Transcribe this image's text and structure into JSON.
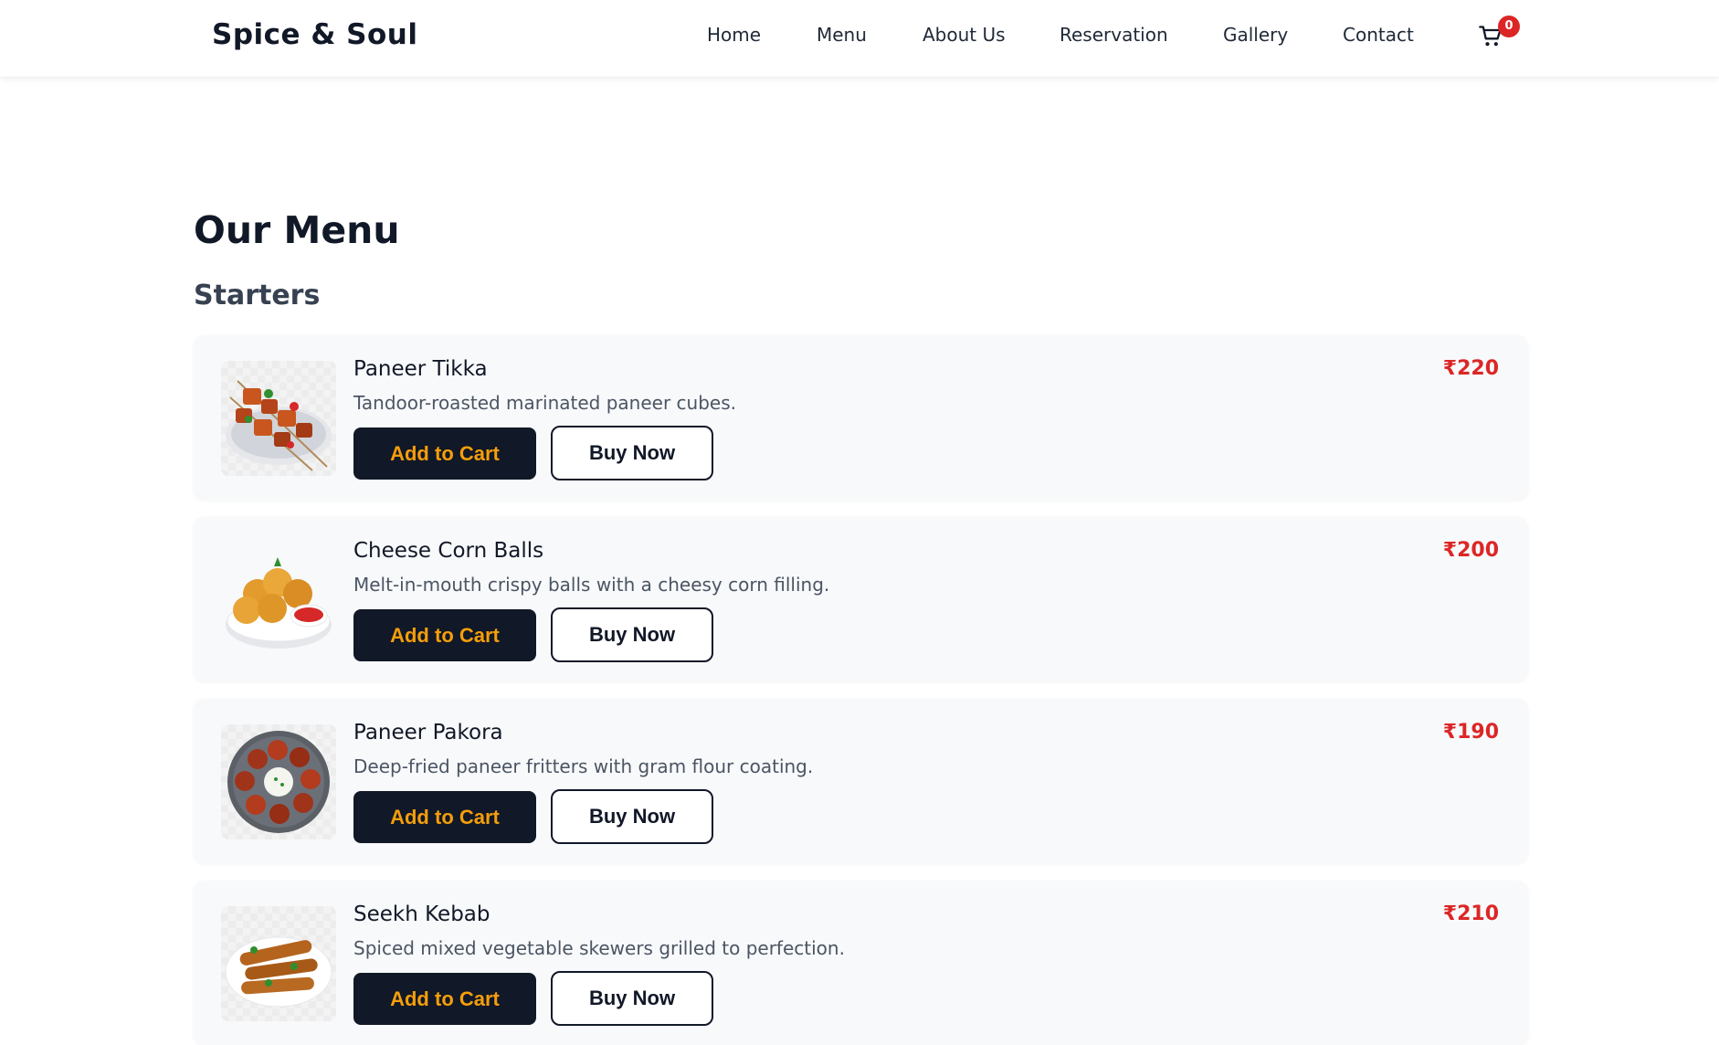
{
  "header": {
    "brand": "Spice & Soul",
    "nav": [
      "Home",
      "Menu",
      "About Us",
      "Reservation",
      "Gallery",
      "Contact"
    ],
    "cart_count": "0",
    "cart_icon": "shopping-cart-icon"
  },
  "page": {
    "title": "Our Menu",
    "section": "Starters"
  },
  "buttons": {
    "add_to_cart": "Add to Cart",
    "buy_now": "Buy Now"
  },
  "items": [
    {
      "name": "Paneer Tikka",
      "description": "Tandoor-roasted marinated paneer cubes.",
      "price": "₹220"
    },
    {
      "name": "Cheese Corn Balls",
      "description": "Melt-in-mouth crispy balls with a cheesy corn filling.",
      "price": "₹200"
    },
    {
      "name": "Paneer Pakora",
      "description": "Deep-fried paneer fritters with gram flour coating.",
      "price": "₹190"
    },
    {
      "name": "Seekh Kebab",
      "description": "Spiced mixed vegetable skewers grilled to perfection.",
      "price": "₹210"
    }
  ],
  "colors": {
    "accent": "#dc2626",
    "button_dark": "#111827",
    "button_text": "#f59e0b",
    "card_bg": "#f8f9fb"
  }
}
